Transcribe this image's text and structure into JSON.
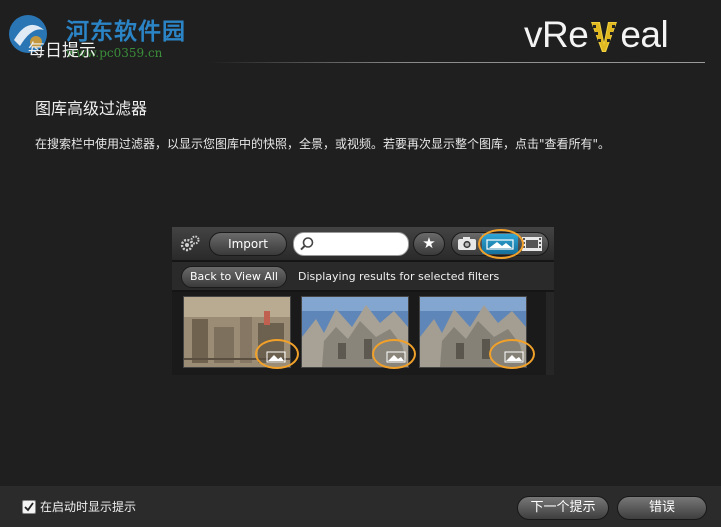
{
  "watermark": {
    "site_name": "河东软件园",
    "url": "www.pc0359.cn",
    "icon": "watermark-logo-icon"
  },
  "header": {
    "title": "每日提示",
    "brand": {
      "prefix": "vRe",
      "suffix": "eal",
      "icon": "film-v-logo-icon"
    }
  },
  "tip": {
    "heading": "图库高级过滤器",
    "body": "在搜索栏中使用过滤器，以显示您图库中的快照，全景，或视频。若要再次显示整个图库，点击\"查看所有\"。"
  },
  "preview": {
    "toolbar": {
      "settings_icon": "gears-icon",
      "import_label": "Import",
      "search_icon": "magnifier-icon",
      "star_icon": "star-icon",
      "filters": [
        "camera-icon",
        "panorama-icon",
        "film-strip-icon"
      ],
      "active_filter": "panorama-icon"
    },
    "back_label": "Back to View All",
    "status": "Displaying results for selected filters",
    "thumbnails": [
      {
        "name": "thumb-1",
        "badge": "panorama-badge-icon"
      },
      {
        "name": "thumb-2",
        "badge": "panorama-badge-icon"
      },
      {
        "name": "thumb-3",
        "badge": "panorama-badge-icon"
      }
    ],
    "highlight_color": "#f1a12a",
    "active_filter_color": "#2fa6d6"
  },
  "footer": {
    "show_on_startup": {
      "label": "在启动时显示提示",
      "checked": true
    },
    "next_label": "下一个提示",
    "close_label": "错误"
  }
}
